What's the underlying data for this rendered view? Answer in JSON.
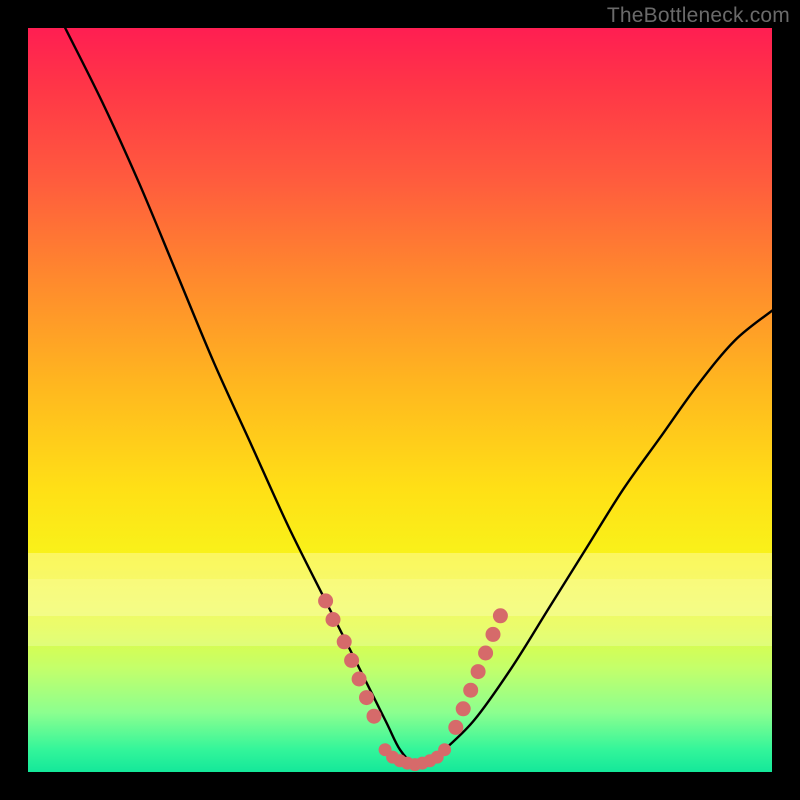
{
  "watermark": "TheBottleneck.com",
  "colors": {
    "frame": "#000000",
    "curve_stroke": "#000000",
    "marker_fill": "#d66a6a",
    "marker_stroke": "#b24e4e",
    "gradient_top": "#ff1e52",
    "gradient_bottom": "#14e89a",
    "watermark_text": "#6a6a6a"
  },
  "chart_data": {
    "type": "line",
    "title": "",
    "xlabel": "",
    "ylabel": "",
    "xlim": [
      0,
      100
    ],
    "ylim": [
      0,
      100
    ],
    "grid": false,
    "legend": false,
    "annotations": [
      "TheBottleneck.com"
    ],
    "series": [
      {
        "name": "bottleneck-curve",
        "comment": "V-shaped curve; y is approximate (percent of plot height from bottom). Minimum around x≈52.",
        "x": [
          5,
          10,
          15,
          20,
          25,
          30,
          35,
          40,
          44,
          48,
          50,
          52,
          54,
          56,
          60,
          65,
          70,
          75,
          80,
          85,
          90,
          95,
          100
        ],
        "y": [
          100,
          90,
          79,
          67,
          55,
          44,
          33,
          23,
          15,
          7,
          3,
          1,
          1,
          3,
          7,
          14,
          22,
          30,
          38,
          45,
          52,
          58,
          62
        ]
      },
      {
        "name": "markers-left",
        "comment": "Cluster of salmon dots along the descending arm near the bottom.",
        "x": [
          40.0,
          41.0,
          42.5,
          43.5,
          44.5,
          45.5,
          46.5
        ],
        "y": [
          23.0,
          20.5,
          17.5,
          15.0,
          12.5,
          10.0,
          7.5
        ]
      },
      {
        "name": "markers-bottom",
        "comment": "Row of salmon dots hugging the minimum.",
        "x": [
          48.0,
          49.0,
          50.0,
          51.0,
          52.0,
          53.0,
          54.0,
          55.0,
          56.0
        ],
        "y": [
          3.0,
          2.0,
          1.5,
          1.2,
          1.0,
          1.2,
          1.5,
          2.0,
          3.0
        ]
      },
      {
        "name": "markers-right",
        "comment": "Cluster of salmon dots along the ascending arm near the bottom.",
        "x": [
          57.5,
          58.5,
          59.5,
          60.5,
          61.5,
          62.5,
          63.5
        ],
        "y": [
          6.0,
          8.5,
          11.0,
          13.5,
          16.0,
          18.5,
          21.0
        ]
      }
    ]
  }
}
